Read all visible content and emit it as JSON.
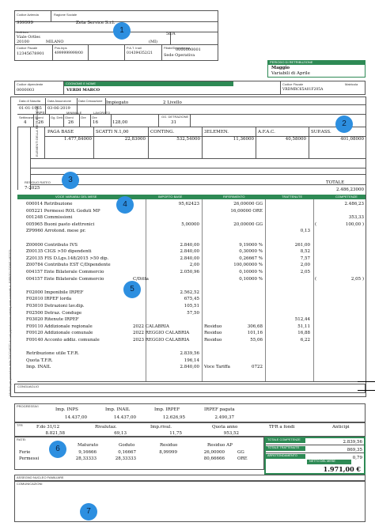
{
  "header": {
    "codice_azienda_label": "Codice Azienda",
    "codice_azienda": "999999",
    "ragione_sociale_label": "Ragione Sociale",
    "ragione_sociale": "Zeta Service S.r.l.",
    "indirizzo_label": "Indirizzo",
    "indirizzo": "Viale Ortles",
    "cap": "20100",
    "citta": "MILANO",
    "provincia": "(MI)",
    "civico": "56/A",
    "codice_fiscale_label": "Codice Fiscale",
    "codice_fiscale": "12345678901",
    "pos_inps_label": "Pos.Inps",
    "pos_inps": "4999999999/00",
    "pat_inail_label": "P.A.T. Inail",
    "pat_inail": "014394352/21",
    "filiale_label": "Filiale/Dipendenza",
    "filiale": "0000000001",
    "sede": "Sede Operativa"
  },
  "periodo": {
    "label": "PERIODO DI RETRIBUZIONE",
    "mese": "Maggio",
    "note": "Variabili di Aprile"
  },
  "dipendente": {
    "codice_label": "Codice dipendente",
    "codice": "0000003",
    "nome_label": "COGNOME E NOME",
    "nome": "VERDI MARCO",
    "cf_label": "Codice Fiscale",
    "cf": "VRDMRC65A01F205A",
    "matricola_label": "Matricola"
  },
  "rapporto": {
    "nascita_label": "Data di Nascita",
    "nascita": "01-01-1965",
    "assunzione_label": "Data Assunzione",
    "assunzione": "03-06-2019",
    "cessazione_label": "Data Cessazione",
    "qualifica": "Impiegato",
    "livello": "2 Livello"
  },
  "inps_row": {
    "labels": [
      "Settimane",
      "Giorni",
      "Gg. Detr.",
      "Giorni",
      "Ore",
      "Ore",
      "Giorni"
    ],
    "group_labels": [
      "INPS",
      "MINIMALE",
      "LAVORATO",
      "GG. DETRAZIONE"
    ],
    "values": [
      "4",
      "26",
      "26",
      "16",
      "128,00",
      "",
      "31"
    ]
  },
  "elementi": {
    "side_label": "ELEMENTI DELLA RETRIBUZIONE",
    "headers": [
      "PAGA BASE",
      "SCATTI N.1,00",
      "CONTING.",
      "3ELEMEN.",
      "A.F.A.C.",
      "SUP.ASS."
    ],
    "values": [
      "1.477,84000",
      "22,83000",
      "532,54000",
      "11,36000",
      "40,58000",
      "401,08000"
    ],
    "totale_label": "TOTALE",
    "totale": "2.486,23000"
  },
  "ratei": {
    "label": "RESIDUO RATEO",
    "periodo": "7-2025"
  },
  "voci_headers": [
    "VOCE VARIABILI DEL MESE",
    "IMPORTO BASE",
    "RIFERIMENTO",
    "TRATTENUTE",
    "COMPETENZE"
  ],
  "voci": [
    {
      "desc": "000014 Retribuzione",
      "base": "95,62423",
      "rif": "26,00000 GG",
      "tratt": "",
      "comp": "2.486,23"
    },
    {
      "desc": "005221 Permessi ROL Goduti MP",
      "base": "",
      "rif": "16,00000 ORE",
      "tratt": "",
      "comp": ""
    },
    {
      "desc": "001248 Commissioni",
      "base": "",
      "rif": "",
      "tratt": "",
      "comp": "353,33"
    },
    {
      "desc": "005965 Buoni pasto elettronici",
      "base": "5,00000",
      "rif": "20,00000 GG",
      "tratt": "(",
      "comp": "100,00 )"
    },
    {
      "desc": "ZP9960 Arrotond. mese pr.",
      "base": "",
      "rif": "",
      "tratt": "0,13",
      "comp": ""
    },
    {
      "desc": "",
      "base": "",
      "rif": "",
      "tratt": "",
      "comp": ""
    },
    {
      "desc": "Z00000 Contributo IVS",
      "base": "2.840,00",
      "rif": "9,19000 %",
      "tratt": "261,00",
      "comp": ""
    },
    {
      "desc": "Z00135 CIGS >50 dipendenti",
      "base": "2.840,00",
      "rif": "0,30000 %",
      "tratt": "8,52",
      "comp": ""
    },
    {
      "desc": "Z20135 FIS D.Lgs.148/2015 >50 dip.",
      "base": "2.840,00",
      "rif": "0,26667 %",
      "tratt": "7,57",
      "comp": ""
    },
    {
      "desc": "Z00784 Contributo EST C/Dipendente",
      "base": "2,00",
      "rif": "100,00000 %",
      "tratt": "2,00",
      "comp": ""
    },
    {
      "desc": "004157 Ente Bilaterale Commercio",
      "base": "2.050,96",
      "rif": "0,10000 %",
      "tratt": "2,05",
      "comp": ""
    },
    {
      "desc": "004157 Ente Bilaterale Commercio",
      "base": "C/Ditta",
      "rif": "0,10000 %",
      "tratt": "(",
      "comp": "2,05 )"
    },
    {
      "desc": "",
      "base": "",
      "rif": "",
      "tratt": "",
      "comp": ""
    },
    {
      "desc": "F02000 Imponibile IRPEF",
      "base": "2.562,52",
      "rif": "",
      "tratt": "",
      "comp": ""
    },
    {
      "desc": "F02010 IRPEF lorda",
      "base": "675,45",
      "rif": "",
      "tratt": "",
      "comp": ""
    },
    {
      "desc": "F03010 Detrazioni lav.dip.",
      "base": "105,51",
      "rif": "",
      "tratt": "",
      "comp": ""
    },
    {
      "desc": "F02500 Detraz. Conduge",
      "base": "57,50",
      "rif": "",
      "tratt": "",
      "comp": ""
    },
    {
      "desc": "F03020 Ritenute IRPEF",
      "base": "",
      "rif": "",
      "tratt": "512,44",
      "comp": ""
    },
    {
      "desc": "F09110 Addizionale regionale",
      "base": "2022 CALABRIA",
      "rif": "Residuo",
      "rif2": "306,68",
      "tratt": "51,11",
      "comp": ""
    },
    {
      "desc": "F09120 Addizionale comunale",
      "base": "2022 REGGIO CALABRIA",
      "rif": "Residuo",
      "rif2": "101,16",
      "tratt": "16,88",
      "comp": ""
    },
    {
      "desc": "F09140 Acconto addiz. comunale",
      "base": "2023 REGGIO CALABRIA",
      "rif": "Residuo",
      "rif2": "55,06",
      "tratt": "6,22",
      "comp": ""
    },
    {
      "desc": "",
      "base": "",
      "rif": "",
      "tratt": "",
      "comp": ""
    },
    {
      "desc": "Retribuzione utile T.F.R.",
      "base": "2.839,56",
      "rif": "",
      "tratt": "",
      "comp": ""
    },
    {
      "desc": "Quota T.F.R.",
      "base": "196,14",
      "rif": "",
      "tratt": "",
      "comp": ""
    },
    {
      "desc": "Imp. INAIL",
      "base": "2.840,00",
      "rif": "Voce Tariffa",
      "rif2": "0722",
      "tratt": "",
      "comp": ""
    }
  ],
  "side_vertical": "Modello per procedure della ZUCCHETTI di Lodi (riproduzione vietata) www.zucchetti.it - RIPRODUZIONE VIETATA",
  "conguaglio_label": "CONGUAGLIO",
  "progressivi": {
    "label": "PROGRESSIVI",
    "headers": [
      "Imp. INPS",
      "Imp. INAIL",
      "Imp. IRPEF",
      "IRPEF pagata"
    ],
    "values": [
      "14.437,00",
      "14.437,00",
      "12.626,95",
      "2.490,37"
    ]
  },
  "tfr": {
    "label": "TFR",
    "headers": [
      "F.do 31/12",
      "Rivalutaz.",
      "Imp.rival.",
      "Quota anno",
      "TFR a fondi",
      "Anticipi"
    ],
    "values": [
      "8.821,58",
      "69,13",
      "11,75",
      "953,52",
      "",
      ""
    ]
  },
  "ratei_tab": {
    "label": "RATEI",
    "headers": [
      "Maturato",
      "Goduto",
      "Residuo",
      "Residuo AP"
    ],
    "rows": [
      {
        "name": "Ferie",
        "vals": [
          "9,16666",
          "0,16667",
          "8,99999",
          "26,00000",
          "GG"
        ]
      },
      {
        "name": "Permessi",
        "vals": [
          "28,33333",
          "28,33333",
          "80,66666",
          "ORE"
        ]
      }
    ]
  },
  "totali": {
    "competenze_label": "TOTALE COMPETENZE",
    "competenze": "2.839,56",
    "trattenute_label": "TOTALE TRATTENUTE",
    "trattenute": "869,35",
    "arrotondamento_label": "ARROTONDAMENTO",
    "arrotondamento": "0,79",
    "netto_label": "NETTO DEL MESE",
    "netto": "1.971,00 €"
  },
  "assegno_label": "ASSEGNO NUCLEO FAMILIARE",
  "comunicazioni_label": "COMUNICAZIONI",
  "badges": [
    "1",
    "2",
    "3",
    "4",
    "5",
    "6",
    "7"
  ]
}
